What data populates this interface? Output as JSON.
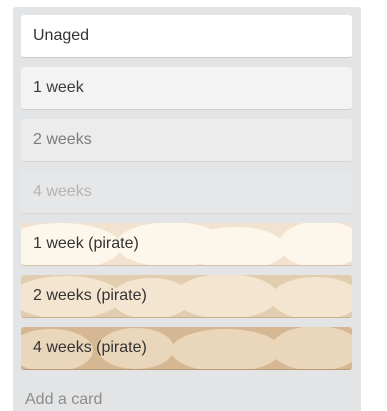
{
  "list": {
    "cards": [
      {
        "label": "Unaged"
      },
      {
        "label": "1 week"
      },
      {
        "label": "2 weeks"
      },
      {
        "label": "4 weeks"
      },
      {
        "label": "1 week (pirate)"
      },
      {
        "label": "2 weeks (pirate)"
      },
      {
        "label": "4 weeks (pirate)"
      }
    ],
    "add_card_label": "Add a card"
  },
  "colors": {
    "list_background": "#e2e4e6",
    "pirate_blob_1week": "#fdf6ea",
    "pirate_blob_2weeks": "#f4e5d0",
    "pirate_blob_4weeks": "#ead6bb"
  }
}
